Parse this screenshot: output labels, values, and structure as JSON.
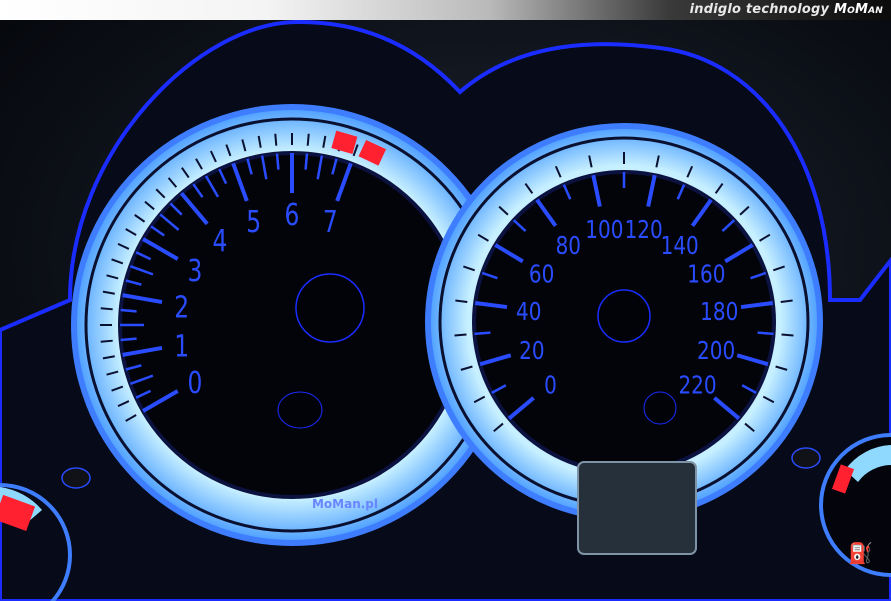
{
  "header": {
    "tagline": "indiglo technology",
    "brand": "MoMan"
  },
  "tachometer": {
    "labels": [
      "0",
      "1",
      "2",
      "3",
      "4",
      "5",
      "6",
      "7"
    ],
    "redline_marks": 2,
    "logo": "MoMan.pl"
  },
  "speedometer": {
    "labels": [
      "0",
      "20",
      "40",
      "60",
      "80",
      "100",
      "120",
      "140",
      "160",
      "180",
      "200",
      "220"
    ]
  },
  "colors": {
    "glow": "#8fd9ff",
    "ring": "#5aa8ff",
    "ink": "#2a4cff",
    "redline": "#ff2030",
    "bezel": "#1a2cff"
  }
}
